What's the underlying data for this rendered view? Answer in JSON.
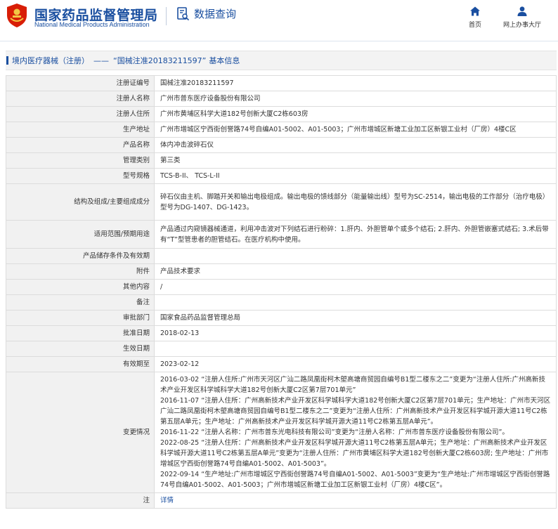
{
  "header": {
    "site_title": "国家药品监督管理局",
    "site_subtitle": "National Medical Products Administration",
    "section_title": "数据查询",
    "nav": {
      "home": "首页",
      "online_hall": "网上办事大厅"
    }
  },
  "breadcrumb": {
    "category": "境内医疗器械（注册）",
    "separator": "——",
    "record": "“国械注准20183211597”",
    "suffix": "基本信息"
  },
  "rows": [
    {
      "label": "注册证编号",
      "value": "国械注准20183211597"
    },
    {
      "label": "注册人名称",
      "value": "广州市普东医疗设备股份有限公司"
    },
    {
      "label": "注册人住所",
      "value": "广州市黄埔区科学大道182号创新大厦C2栋603房"
    },
    {
      "label": "生产地址",
      "value": "广州市增城区宁西街创誉路74号自编A01-5002、A01-5003；广州市增城区新塘工业加工区新银工业村（厂房）4楼C区"
    },
    {
      "label": "产品名称",
      "value": "体内冲击波碎石仪"
    },
    {
      "label": "管理类别",
      "value": "第三类"
    },
    {
      "label": "型号规格",
      "value": "TCS-B-II、 TCS-L-II"
    },
    {
      "label": "结构及组成/主要组成成分",
      "value": "碎石仪由主机、脚踏开关和输出电极组成。输出电极的馈线部分（能量输出线）型号为SC-2514，输出电极的工作部分（治疗电极）型号为DG-1407、DG-1423。"
    },
    {
      "label": "适用范围/预期用途",
      "value": "产品通过内窥镜器械通道，利用冲击波对下列结石进行粉碎：1.肝内、外胆管单个或多个结石; 2.肝内、外胆管嵌塞式结石; 3.术后带有“T”型管患者的胆管结石。在医疗机构中使用。"
    },
    {
      "label": "产品储存条件及有效期",
      "value": ""
    },
    {
      "label": "附件",
      "value": "产品技术要求"
    },
    {
      "label": "其他内容",
      "value": "/"
    },
    {
      "label": "备注",
      "value": ""
    },
    {
      "label": "审批部门",
      "value": "国家食品药品监督管理总局"
    },
    {
      "label": "批准日期",
      "value": "2018-02-13"
    },
    {
      "label": "生效日期",
      "value": ""
    },
    {
      "label": "有效期至",
      "value": "2023-02-12"
    }
  ],
  "changes": {
    "label": "变更情况",
    "entries": [
      "2016-03-02 “注册人住所:广州市天河区广汕二路凤凰街柯木塱高塘商贸园自编号B1型二楼东之二”变更为“注册人住所:广州高新技术产业开发区科学城科学大道182号创新大厦C2区第7层701单元”",
      "2016-11-07 “注册人住所：广州高新技术产业开发区科学城科学大道182号创新大厦C2区第7层701单元；生产地址：广州市天河区广汕二路凤凰街柯木塱高塘商贸园自编号B1型二楼东之二”变更为“注册人住所：广州高新技术产业开发区科学城开源大道11号C2栋第五层A单元；生产地址：广州高新技术产业开发区科学城开源大道11号C2栋第五层A单元”。",
      "2016-11-22 “注册人名称：广州市普东光电科技有限公司”变更为“注册人名称：广州市普东医疗设备股份有限公司”。",
      "2022-08-25 “注册人住所：广州高新技术产业开发区科学城开源大道11号C2栋第五层A单元；生产地址：广州高新技术产业开发区科学城开源大道11号C2栋第五层A单元”变更为“注册人住所：广州市黄埔区科学大道182号创新大厦C2栋603房; 生产地址：广州市增城区宁西街创誉路74号自编A01-5002、A01-5003”。",
      "2022-09-14 “生产地址:广州市增城区宁西街创誉路74号自编A01-5002、A01-5003”变更为“生产地址:广州市增城区宁西街创誉路74号自编A01-5002、A01-5003；广州市增城区新塘工业加工区新银工业村（厂房）4楼C区”。"
    ]
  },
  "note_row": {
    "label": "注",
    "link_text": "详情"
  },
  "colors": {
    "brand_blue": "#1a4fa0",
    "emblem_red": "#d81e06",
    "label_bg": "#f1f1f1",
    "border": "#dcdcdc"
  }
}
